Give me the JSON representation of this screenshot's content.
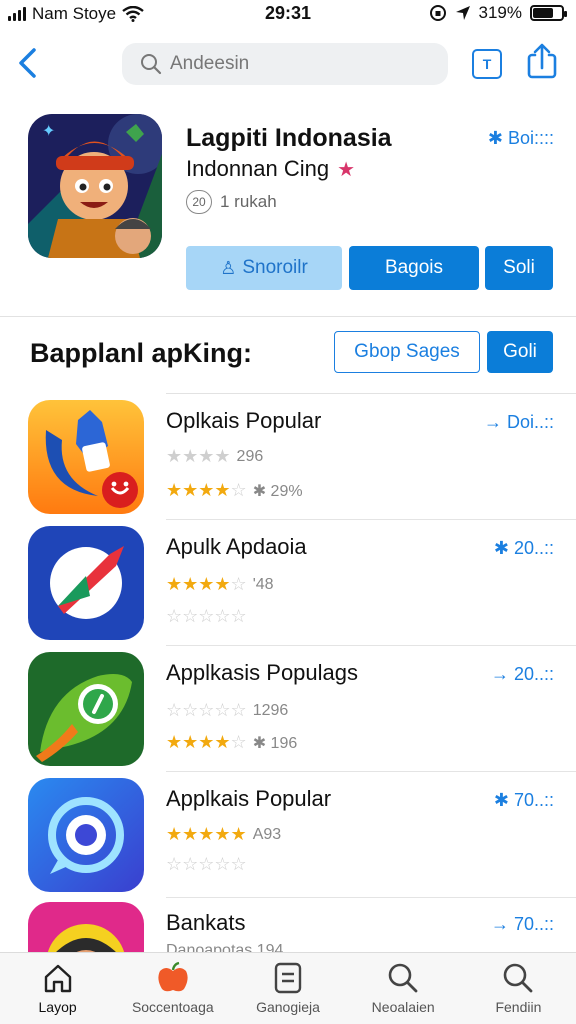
{
  "status_bar": {
    "carrier": "Nam Stoye",
    "time": "29:31",
    "battery": "319%"
  },
  "nav": {
    "search_placeholder": "Andeesin",
    "box_glyph": "T"
  },
  "hero": {
    "title": "Lagpiti Indonasia",
    "subtitle": "Indonnan Cing",
    "meta_badge": "20",
    "meta_text": "1 rukah",
    "rating": "✱ Boi::::",
    "buttons": [
      "Snoroilr",
      "Bagois",
      "Soli"
    ]
  },
  "section": {
    "title": "Bapplanl apKing:",
    "button_outline": "Gbop Sages",
    "button_fill": "Goli"
  },
  "apps": [
    {
      "name": "Oplkais Popular",
      "price": "→ Doi..::",
      "line1": "296",
      "line2": "✱ 29%"
    },
    {
      "name": "Apulk Apdaoia",
      "price": "✱ 20..::",
      "line1": "'48",
      "line2": ""
    },
    {
      "name": "Applkasis Populags",
      "price": "→ 20..::",
      "line1": "1296",
      "line2": "✱ 196"
    },
    {
      "name": "Applkais Popular",
      "price": "✱ 70..::",
      "line1": "A93",
      "line2": ""
    },
    {
      "name": "Bankats",
      "price": "→ 70..::",
      "line1": "Danoapotas 194",
      "line2": ""
    }
  ],
  "tabs": [
    {
      "label": "Layop",
      "icon": "home-icon"
    },
    {
      "label": "Soccentoaga",
      "icon": "apple-icon"
    },
    {
      "label": "Ganogieja",
      "icon": "list-icon"
    },
    {
      "label": "Neoalaien",
      "icon": "search-icon"
    },
    {
      "label": "Fendiin",
      "icon": "search-icon"
    }
  ],
  "colors": {
    "accent": "#0b7dd8",
    "accent_light": "#a7d6f7",
    "star": "#f2a90f"
  }
}
